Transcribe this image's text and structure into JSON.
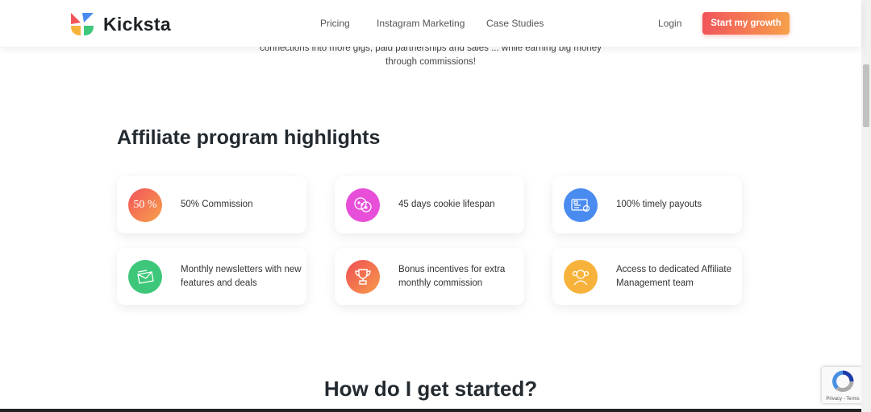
{
  "header": {
    "brand": "Kicksta",
    "nav": [
      "Pricing",
      "Instagram Marketing",
      "Case Studies"
    ],
    "login": "Login",
    "cta": "Start my growth"
  },
  "intro": {
    "line1": "connections into more gigs, paid partnerships and sales ... while earning big money",
    "line2": "through commissions!"
  },
  "highlights": {
    "title": "Affiliate program highlights",
    "items": [
      {
        "label": "50% Commission",
        "icon": "percent-icon",
        "badge": "50 %",
        "color": "#f0604a"
      },
      {
        "label": "45 days cookie lifespan",
        "icon": "cookie-icon",
        "color": "#e84fd8"
      },
      {
        "label": "100% timely payouts",
        "icon": "payment-card-icon",
        "color": "#4a8bf0"
      },
      {
        "label": "Monthly newsletters with new features and deals",
        "icon": "envelope-icon",
        "color": "#3ec77a"
      },
      {
        "label": "Bonus incentives for extra monthly commission",
        "icon": "trophy-icon",
        "color": "#f0604a"
      },
      {
        "label": "Access to dedicated Affiliate Management team",
        "icon": "team-icon",
        "color": "#f7b23b"
      }
    ]
  },
  "started": {
    "title": "How do I get started?"
  },
  "recaptcha": {
    "text": "Privacy - Terms"
  }
}
